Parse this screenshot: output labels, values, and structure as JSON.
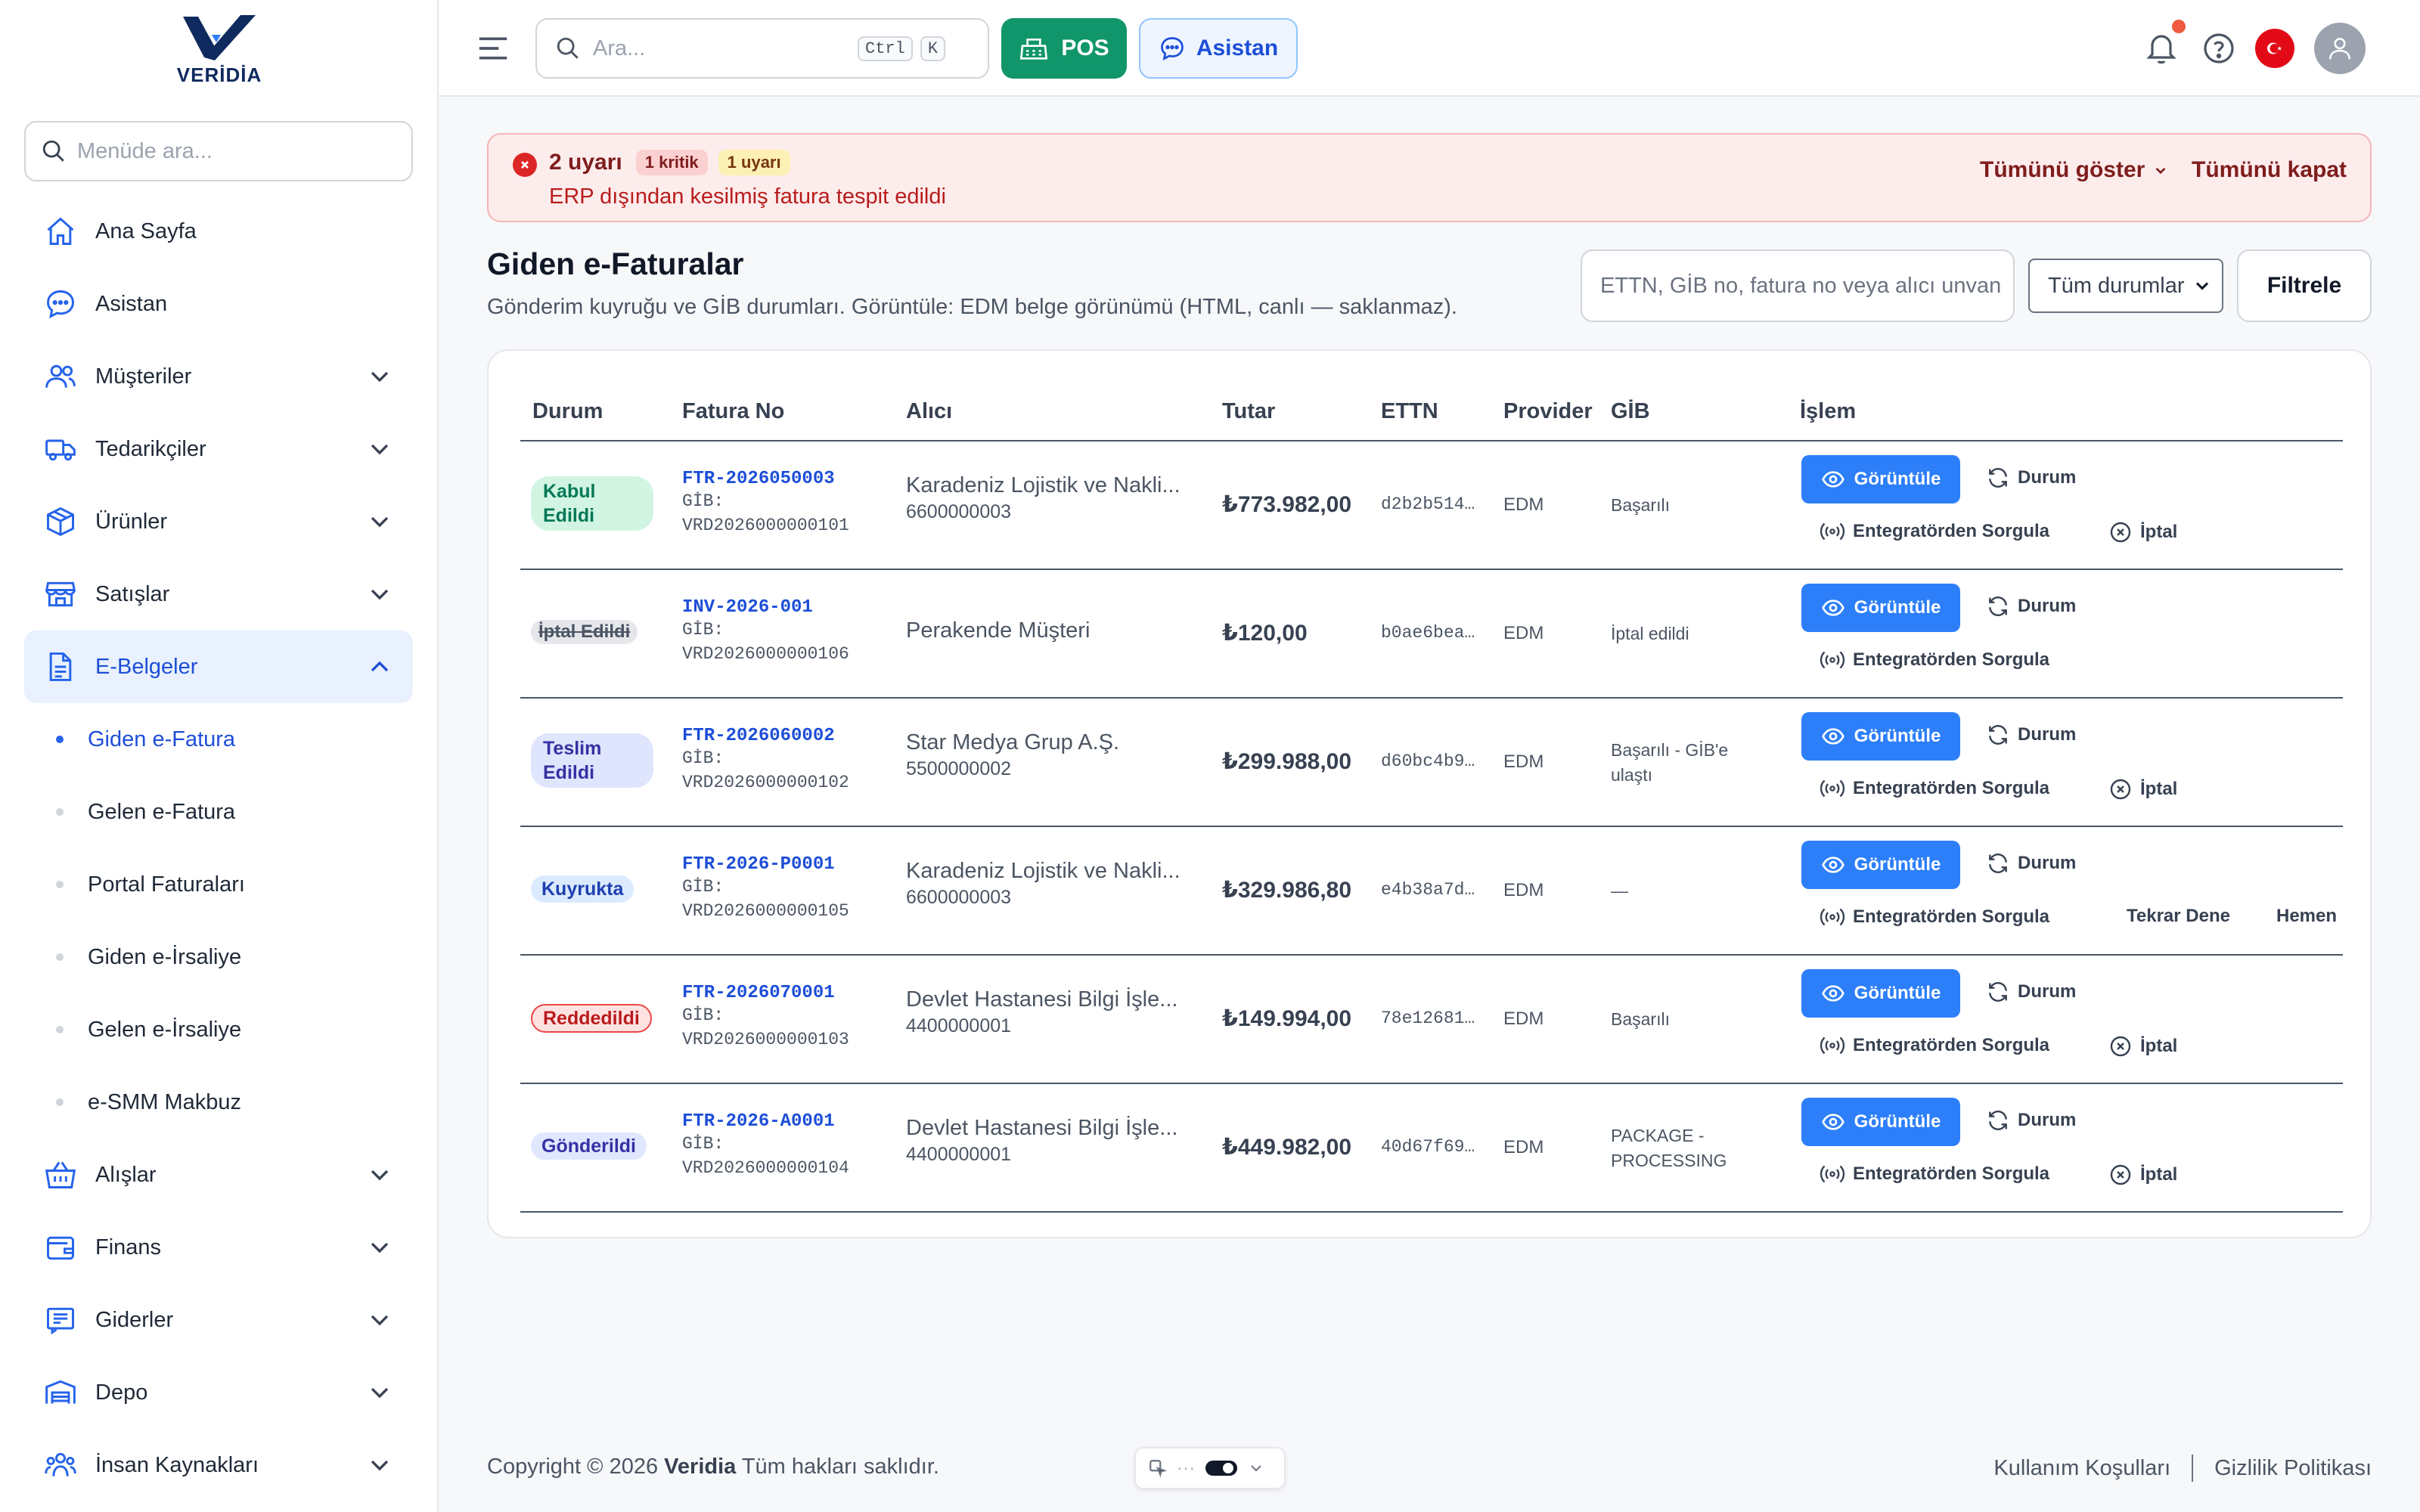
{
  "brand": {
    "name": "VERİDİA"
  },
  "sidebar": {
    "search_placeholder": "Menüde ara...",
    "items": [
      {
        "label": "Ana Sayfa",
        "icon": "home-icon"
      },
      {
        "label": "Asistan",
        "icon": "chat-icon"
      },
      {
        "label": "Müşteriler",
        "icon": "users-icon"
      },
      {
        "label": "Tedarikçiler",
        "icon": "truck-icon"
      },
      {
        "label": "Ürünler",
        "icon": "box-icon"
      },
      {
        "label": "Satışlar",
        "icon": "store-icon"
      },
      {
        "label": "E-Belgeler",
        "icon": "document-icon"
      },
      {
        "label": "Alışlar",
        "icon": "basket-icon"
      },
      {
        "label": "Finans",
        "icon": "wallet-icon"
      },
      {
        "label": "Giderler",
        "icon": "receipt-icon"
      },
      {
        "label": "Depo",
        "icon": "warehouse-icon"
      },
      {
        "label": "İnsan Kaynakları",
        "icon": "people-icon"
      }
    ],
    "sub_items": [
      {
        "label": "Giden e-Fatura"
      },
      {
        "label": "Gelen e-Fatura"
      },
      {
        "label": "Portal Faturaları"
      },
      {
        "label": "Giden e-İrsaliye"
      },
      {
        "label": "Gelen e-İrsaliye"
      },
      {
        "label": "e-SMM Makbuz"
      }
    ]
  },
  "topbar": {
    "search_placeholder": "Ara...",
    "kbd_ctrl": "Ctrl",
    "kbd_k": "K",
    "pos_label": "POS",
    "assistant_label": "Asistan"
  },
  "alert": {
    "title": "2 uyarı",
    "critical": "1 kritik",
    "warning": "1 uyarı",
    "message": "ERP dışından kesilmiş fatura tespit edildi",
    "show_all": "Tümünü göster",
    "close_all": "Tümünü kapat"
  },
  "page": {
    "title": "Giden e-Faturalar",
    "subtitle": "Gönderim kuyruğu ve GİB durumları. Görüntüle: EDM belge görünümü (HTML, canlı — saklanmaz).",
    "filter_placeholder": "ETTN, GİB no, fatura no veya alıcı unvanı",
    "status_select": "Tüm durumlar",
    "filter_button": "Filtrele"
  },
  "table": {
    "headers": {
      "status": "Durum",
      "invoice_no": "Fatura No",
      "receiver": "Alıcı",
      "amount": "Tutar",
      "ettn": "ETTN",
      "provider": "Provider",
      "gib": "GİB",
      "action": "İşlem"
    },
    "actions": {
      "view": "Görüntüle",
      "status": "Durum",
      "query": "Entegratörden Sorgula",
      "cancel": "İptal",
      "retry": "Tekrar Dene",
      "now": "Hemen"
    },
    "rows": [
      {
        "status": "Kabul Edildi",
        "invoice_no": "FTR-2026050003",
        "gib_no": "GİB: VRD2026000000101",
        "receiver": "Karadeniz Lojistik ve Nakli...",
        "vkn": "6600000003",
        "amount": "₺773.982,00",
        "ettn": "d2b2b514…",
        "provider": "EDM",
        "gib_status": "Başarılı"
      },
      {
        "status": "İptal Edildi",
        "invoice_no": "INV-2026-001",
        "gib_no": "GİB: VRD2026000000106",
        "receiver": "Perakende Müşteri",
        "vkn": "",
        "amount": "₺120,00",
        "ettn": "b0ae6bea…",
        "provider": "EDM",
        "gib_status": "İptal edildi"
      },
      {
        "status": "Teslim Edildi",
        "invoice_no": "FTR-2026060002",
        "gib_no": "GİB: VRD2026000000102",
        "receiver": "Star Medya Grup A.Ş.",
        "vkn": "5500000002",
        "amount": "₺299.988,00",
        "ettn": "d60bc4b9…",
        "provider": "EDM",
        "gib_status": "Başarılı - GİB'e ulaştı"
      },
      {
        "status": "Kuyrukta",
        "invoice_no": "FTR-2026-P0001",
        "gib_no": "GİB: VRD2026000000105",
        "receiver": "Karadeniz Lojistik ve Nakli...",
        "vkn": "6600000003",
        "amount": "₺329.986,80",
        "ettn": "e4b38a7d…",
        "provider": "EDM",
        "gib_status": "—"
      },
      {
        "status": "Reddedildi",
        "invoice_no": "FTR-2026070001",
        "gib_no": "GİB: VRD2026000000103",
        "receiver": "Devlet Hastanesi Bilgi İşle...",
        "vkn": "4400000001",
        "amount": "₺149.994,00",
        "ettn": "78e12681…",
        "provider": "EDM",
        "gib_status": "Başarılı"
      },
      {
        "status": "Gönderildi",
        "invoice_no": "FTR-2026-A0001",
        "gib_no": "GİB: VRD2026000000104",
        "receiver": "Devlet Hastanesi Bilgi İşle...",
        "vkn": "4400000001",
        "amount": "₺449.982,00",
        "ettn": "40d67f69…",
        "provider": "EDM",
        "gib_status": "PACKAGE - PROCESSING"
      }
    ]
  },
  "footer": {
    "copyright_prefix": "Copyright © 2026",
    "copyright_brand": "Veridia",
    "copyright_suffix": "Tüm hakları saklıdır.",
    "terms": "Kullanım Koşulları",
    "privacy": "Gizlilik Politikası"
  },
  "colors": {
    "accent": "#2563eb",
    "pos_green": "#10966a",
    "view_button": "#2d7ff9",
    "alert_bg": "#fdecec"
  }
}
